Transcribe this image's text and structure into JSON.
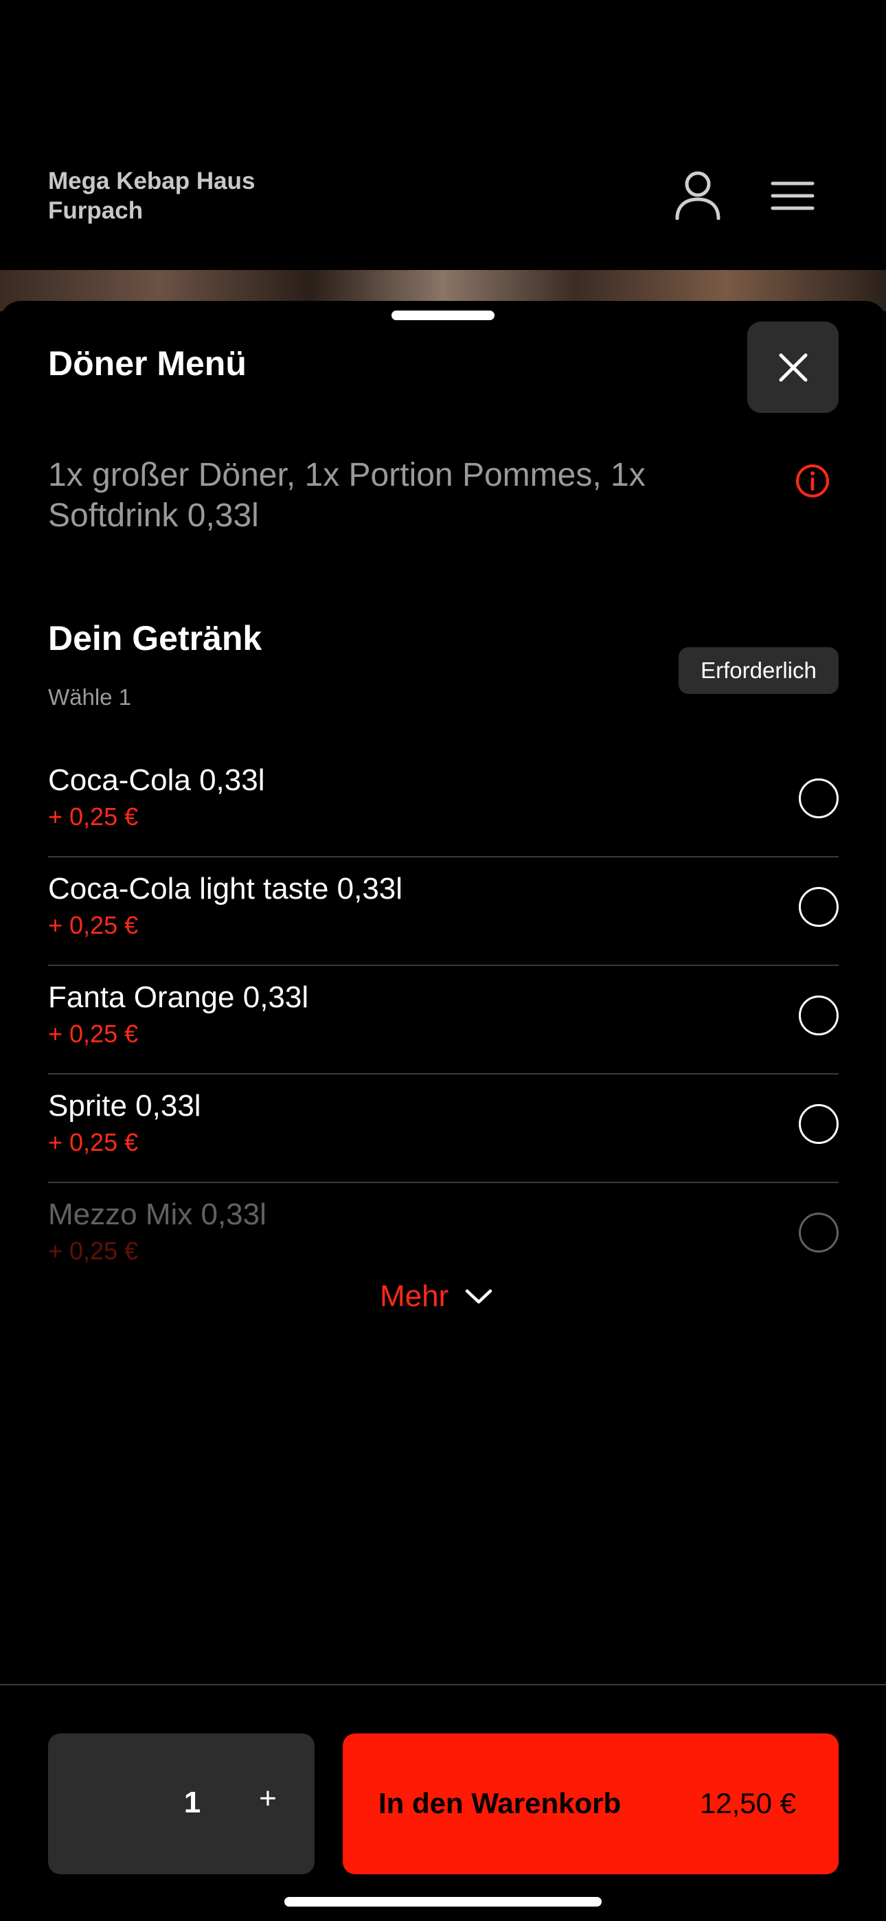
{
  "header": {
    "restaurant_line1": "Mega Kebap Haus",
    "restaurant_line2": "Furpach",
    "icons": [
      "user-icon",
      "menu-icon"
    ]
  },
  "sheet": {
    "title": "Döner Menü",
    "close_icon": "close-icon",
    "description": "1x großer Döner, 1x Portion Pommes, 1x Softdrink 0,33l",
    "info_icon": "info-icon"
  },
  "section": {
    "title": "Dein Getränk",
    "subtitle": "Wähle 1",
    "badge": "Erforderlich"
  },
  "options": [
    {
      "name": "Coca-Cola 0,33l",
      "price": "+ 0,25 €",
      "selected": false
    },
    {
      "name": "Coca-Cola light taste 0,33l",
      "price": "+ 0,25 €",
      "selected": false
    },
    {
      "name": "Fanta Orange 0,33l",
      "price": "+ 0,25 €",
      "selected": false
    },
    {
      "name": "Sprite 0,33l",
      "price": "+ 0,25 €",
      "selected": false
    },
    {
      "name": "Mezzo Mix 0,33l",
      "price": "+ 0,25 €",
      "selected": false
    }
  ],
  "more": {
    "label": "Mehr",
    "icon": "chevron-down-icon"
  },
  "footer": {
    "quantity": "1",
    "plus": "+",
    "cart_label": "In den Warenkorb",
    "cart_price": "12,50 €"
  },
  "colors": {
    "accent": "#ff1a05",
    "price": "#ff2a18",
    "surface": "#2d2d2d"
  }
}
